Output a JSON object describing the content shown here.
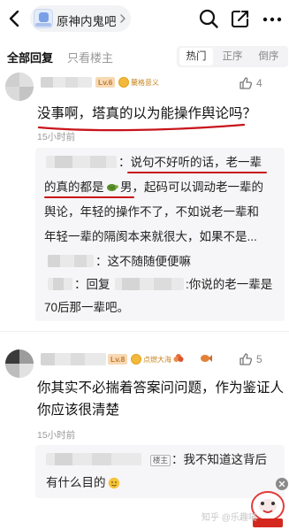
{
  "header": {
    "forum_name": "原神内鬼吧",
    "icons": [
      "back-arrow-icon",
      "search-icon",
      "share-icon",
      "more-icon"
    ]
  },
  "tabs": {
    "all": "全部回复",
    "owner_only": "只看楼主",
    "sort": [
      "热门",
      "正序",
      "倒序"
    ]
  },
  "post1": {
    "level": "Lv.6",
    "medal_title": "蘭格意义",
    "likes": "4",
    "text": "没事啊，塔真的以为能操作舆论吗？",
    "time": "15小时前",
    "sub_replies": {
      "reply1": {
        "line1": "：说句不好听的话，老一辈",
        "line2a": "的真的都是",
        "line2b": "男，起码可以调动老一辈的",
        "line3": "舆论，年轻的操作不了，不如说老一辈和",
        "line4": "年轻一辈的隔阂本来就很大，如果不是..."
      },
      "reply2": "：这不随随便便嘛",
      "reply3": {
        "line1a": "：回复",
        "line1b": ":你说的老一辈是",
        "line2": "70后那一辈吧。"
      }
    }
  },
  "post2": {
    "level": "Lv.8",
    "medal_title": "点燃大海",
    "likes": "5",
    "text_line1": "你其实不必揣着答案问问题，作为鉴证人",
    "text_line2": "你应该很清楚",
    "time": "15小时前",
    "sub_reply": {
      "tag": "楼主",
      "line1": "：我不知道这背后",
      "line2": "有什么目的"
    }
  },
  "watermark": "知乎 @乐趣喵",
  "colors": {
    "highlight_red": "#c8141b",
    "level_badge": "#f7d9b4",
    "sub_box_bg": "#f6f6f8"
  }
}
